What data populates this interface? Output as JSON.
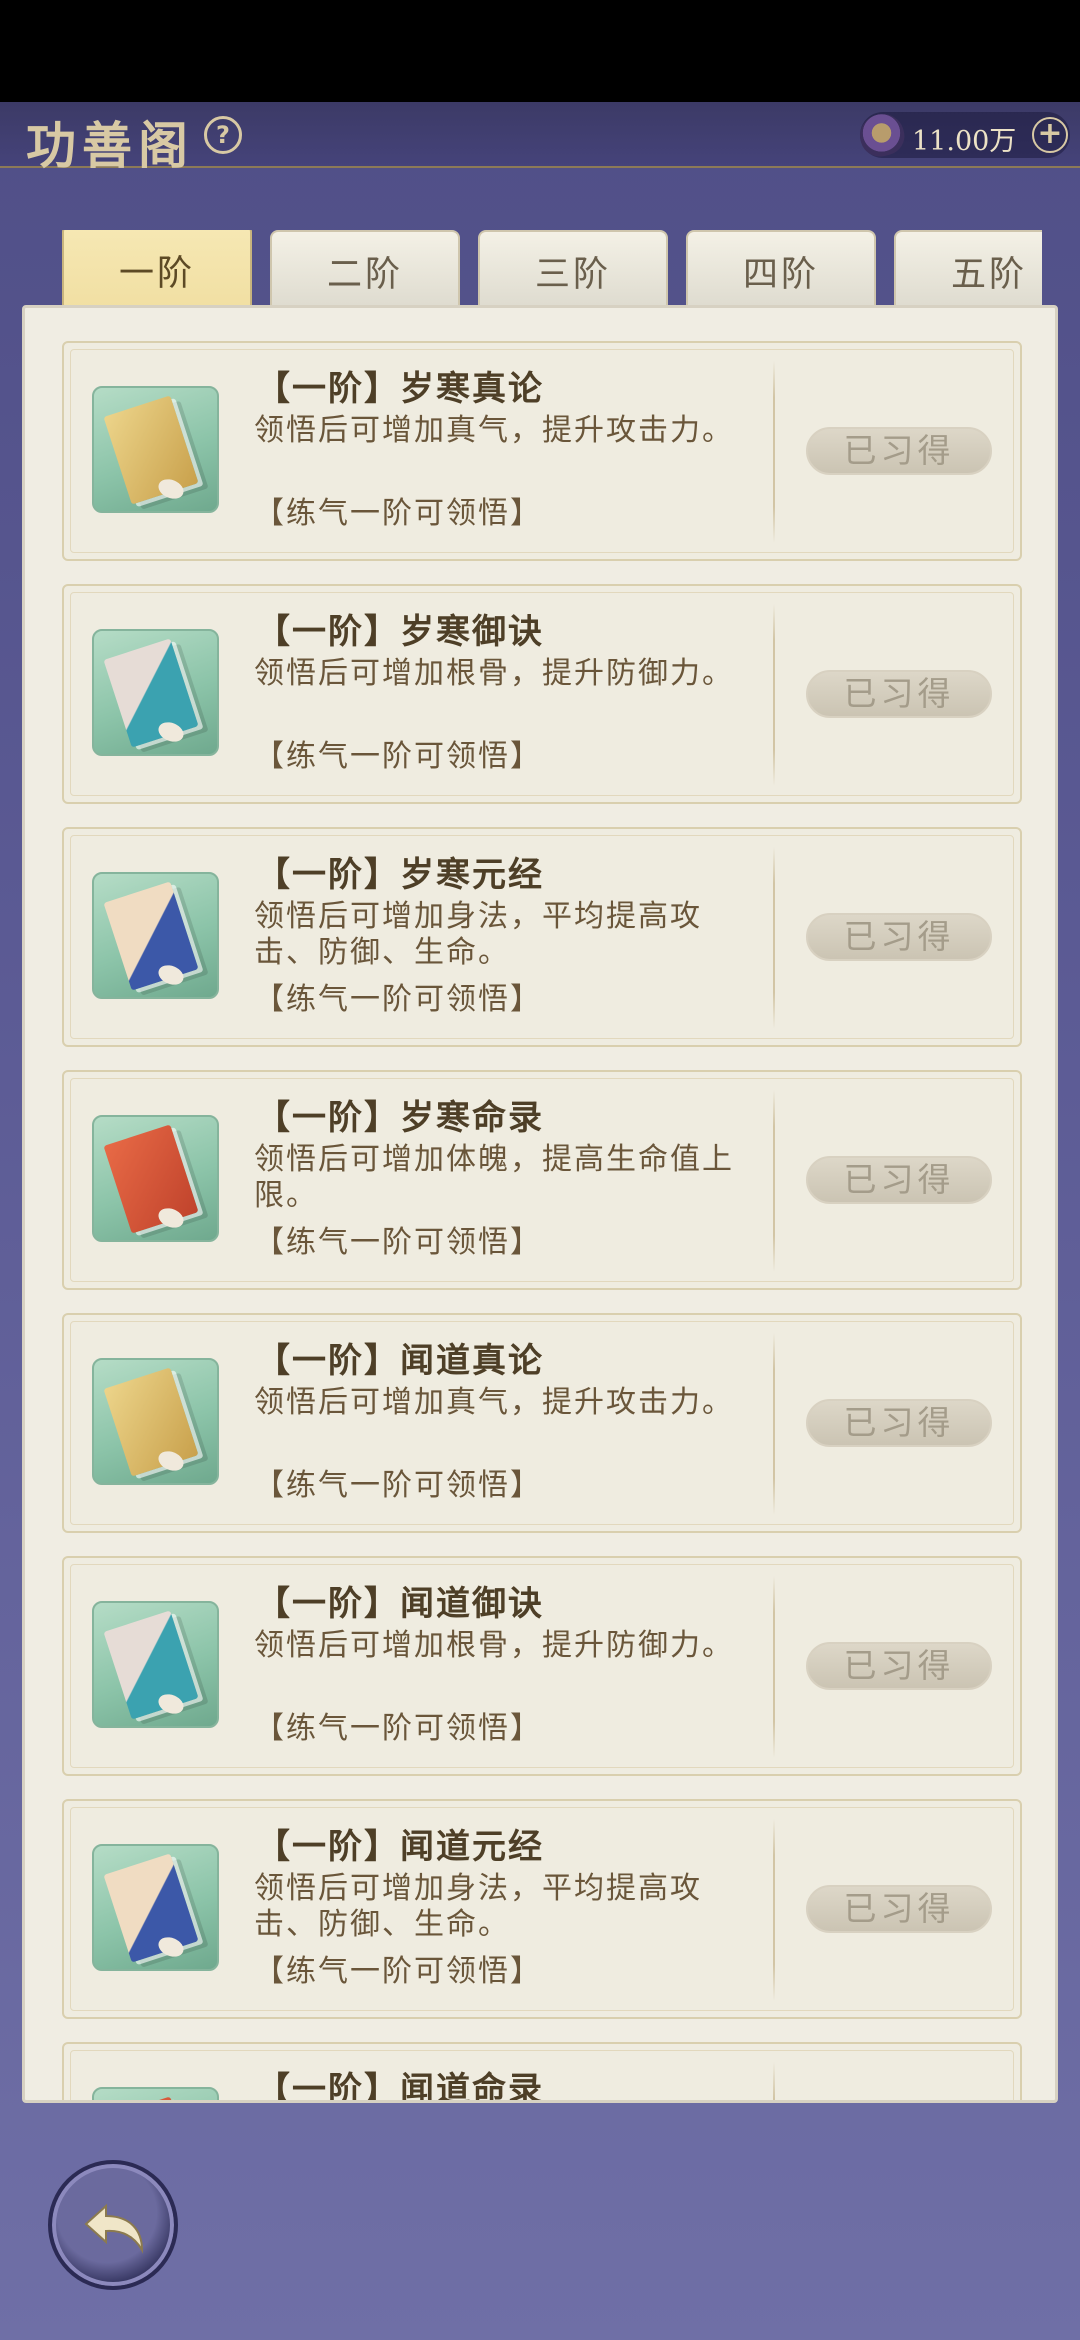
{
  "header": {
    "title": "功善阁",
    "help_label": "?",
    "currency": {
      "icon": "spirit-stone-icon",
      "value": "11.00万",
      "plus_label": "+"
    }
  },
  "tabs": [
    {
      "label": "一阶",
      "active": true
    },
    {
      "label": "二阶",
      "active": false
    },
    {
      "label": "三阶",
      "active": false
    },
    {
      "label": "四阶",
      "active": false
    },
    {
      "label": "五阶",
      "active": false
    }
  ],
  "items": [
    {
      "name": "【一阶】岁寒真论",
      "desc": "领悟后可增加真气，提升攻击力。",
      "req": "【练气一阶可领悟】",
      "button": "已习得",
      "icon": "gold-book-icon"
    },
    {
      "name": "【一阶】岁寒御诀",
      "desc": "领悟后可增加根骨，提升防御力。",
      "req": "【练气一阶可领悟】",
      "button": "已习得",
      "icon": "teal-book-icon"
    },
    {
      "name": "【一阶】岁寒元经",
      "desc": "领悟后可增加身法，平均提高攻击、防御、生命。",
      "req": "【练气一阶可领悟】",
      "button": "已习得",
      "icon": "blue-book-icon"
    },
    {
      "name": "【一阶】岁寒命录",
      "desc": "领悟后可增加体魄，提高生命值上限。",
      "req": "【练气一阶可领悟】",
      "button": "已习得",
      "icon": "red-book-icon"
    },
    {
      "name": "【一阶】闻道真论",
      "desc": "领悟后可增加真气，提升攻击力。",
      "req": "【练气一阶可领悟】",
      "button": "已习得",
      "icon": "gold-book-icon"
    },
    {
      "name": "【一阶】闻道御诀",
      "desc": "领悟后可增加根骨，提升防御力。",
      "req": "【练气一阶可领悟】",
      "button": "已习得",
      "icon": "teal-book-icon"
    },
    {
      "name": "【一阶】闻道元经",
      "desc": "领悟后可增加身法，平均提高攻击、防御、生命。",
      "req": "【练气一阶可领悟】",
      "button": "已习得",
      "icon": "blue-book-icon"
    },
    {
      "name": "【一阶】闻道命录",
      "desc": "",
      "req": "",
      "button": "",
      "icon": "red-book-icon"
    }
  ],
  "back_button": {
    "icon": "back-arrow-icon"
  }
}
